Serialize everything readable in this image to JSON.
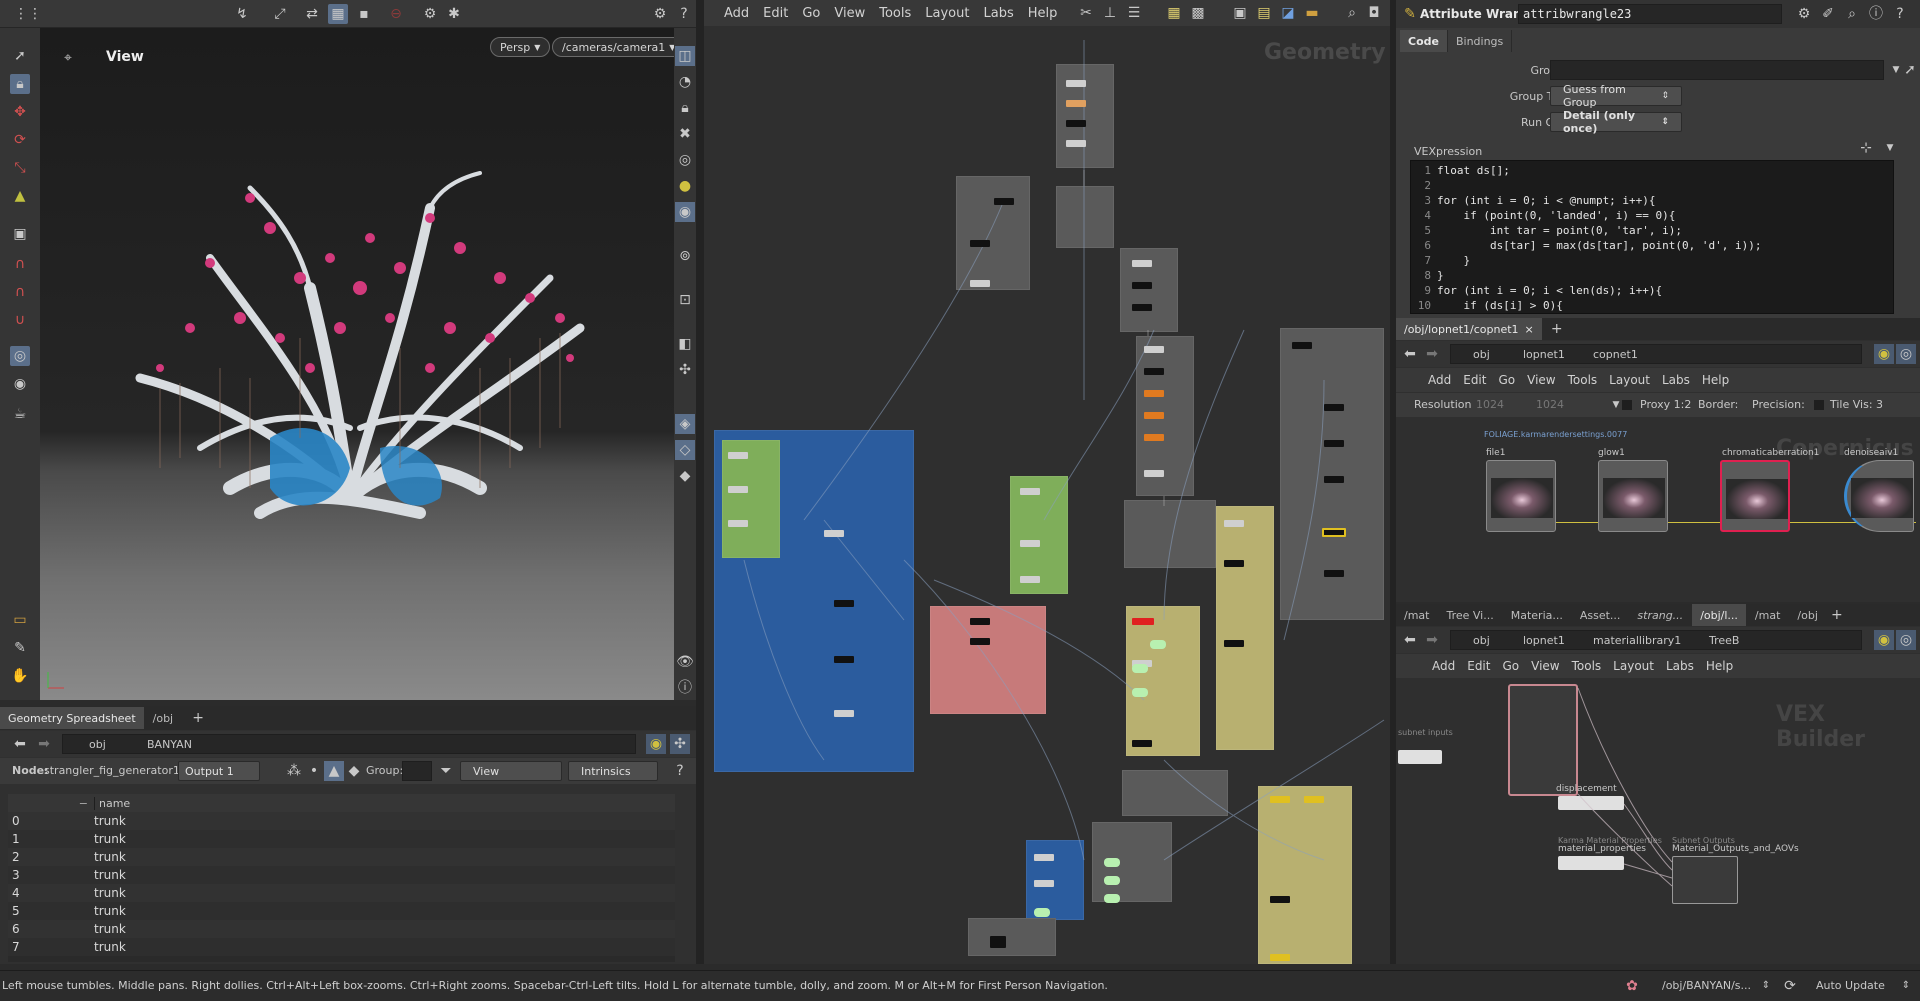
{
  "viewport": {
    "title": "View",
    "projection": "Persp",
    "camera": "/cameras/camera1"
  },
  "network_main": {
    "menu": [
      "Add",
      "Edit",
      "Go",
      "View",
      "Tools",
      "Layout",
      "Labs",
      "Help"
    ],
    "context_label": "Geometry"
  },
  "parameters": {
    "node_type": "Attribute Wrangle",
    "node_name": "attribwrangle23",
    "tabs": [
      "Code",
      "Bindings"
    ],
    "group_label": "Group",
    "group_value": "",
    "group_type_label": "Group Type",
    "group_type_value": "Guess from Group",
    "run_over_label": "Run Over",
    "run_over_value": "Detail (only once)",
    "vex_label": "VEXpression",
    "code_lines": [
      {
        "n": "1",
        "t": "float ds[];"
      },
      {
        "n": "2",
        "t": ""
      },
      {
        "n": "3",
        "t": "for (int i = 0; i < @numpt; i++){"
      },
      {
        "n": "4",
        "t": "    if (point(0, 'landed', i) == 0){"
      },
      {
        "n": "5",
        "t": "        int tar = point(0, 'tar', i);"
      },
      {
        "n": "6",
        "t": "        ds[tar] = max(ds[tar], point(0, 'd', i));"
      },
      {
        "n": "7",
        "t": "    }"
      },
      {
        "n": "8",
        "t": "}"
      },
      {
        "n": "9",
        "t": "for (int i = 0; i < len(ds); i++){"
      },
      {
        "n": "10",
        "t": "    if (ds[i] > 0){"
      }
    ]
  },
  "copnet": {
    "tab_label": "/obj/lopnet1/copnet1",
    "path": [
      "obj",
      "lopnet1",
      "copnet1"
    ],
    "menu": [
      "Add",
      "Edit",
      "Go",
      "View",
      "Tools",
      "Layout",
      "Labs",
      "Help"
    ],
    "resolution_label": "Resolution",
    "res_w": "1024",
    "res_h": "1024",
    "proxy_label": "Proxy 1:2",
    "border_label": "Border:",
    "precision_label": "Precision:",
    "tilevis_label": "Tile Vis: 3",
    "nodes": [
      {
        "name": "file1",
        "sub": "FOLIAGE.karmarendersettings.0077"
      },
      {
        "name": "glow1",
        "sub": ""
      },
      {
        "name": "chromaticaberration1",
        "sub": ""
      },
      {
        "name": "denoiseaiv1",
        "sub": ""
      }
    ],
    "watermark": "Copernicus"
  },
  "matnet": {
    "tabs": [
      "/mat",
      "Tree Vi...",
      "Materia...",
      "Asset...",
      "strang...",
      "/obj/l...",
      "/mat",
      "/obj"
    ],
    "path": [
      "obj",
      "lopnet1",
      "materiallibrary1",
      "TreeB"
    ],
    "menu": [
      "Add",
      "Edit",
      "Go",
      "View",
      "Tools",
      "Layout",
      "Labs",
      "Help"
    ],
    "watermark": "VEX Builder",
    "node_labels": [
      "displacement",
      "Karma Material Properties",
      "material_properties",
      "Subnet Outputs",
      "Material_Outputs_and_AOVs",
      "subnet inputs"
    ]
  },
  "spreadsheet": {
    "tabs": [
      "Geometry Spreadsheet",
      "/obj"
    ],
    "path": [
      "obj",
      "BANYAN"
    ],
    "node_label": "Node:",
    "node_name": "strangler_fig_generator1",
    "output": "Output 1",
    "group_label": "Group:",
    "view_label": "View",
    "intrinsics_label": "Intrinsics",
    "column_header": "name",
    "rows": [
      {
        "i": "0",
        "v": "trunk"
      },
      {
        "i": "1",
        "v": "trunk"
      },
      {
        "i": "2",
        "v": "trunk"
      },
      {
        "i": "3",
        "v": "trunk"
      },
      {
        "i": "4",
        "v": "trunk"
      },
      {
        "i": "5",
        "v": "trunk"
      },
      {
        "i": "6",
        "v": "trunk"
      },
      {
        "i": "7",
        "v": "trunk"
      }
    ]
  },
  "status": {
    "message": "Left mouse tumbles. Middle pans. Right dollies. Ctrl+Alt+Left box-zooms. Ctrl+Right zooms. Spacebar-Ctrl-Left tilts. Hold L for alternate tumble, dolly, and zoom. M or Alt+M for First Person Navigation.",
    "path": "/obj/BANYAN/s...",
    "update_mode": "Auto Update"
  },
  "colors": {
    "accent_yellow": "#d6c23a",
    "box_blue": "#2b5c9e",
    "box_green": "#7fae5a",
    "box_red": "#c77a7a",
    "box_yellow": "#b8b070",
    "blossom": "#d23a7c"
  }
}
